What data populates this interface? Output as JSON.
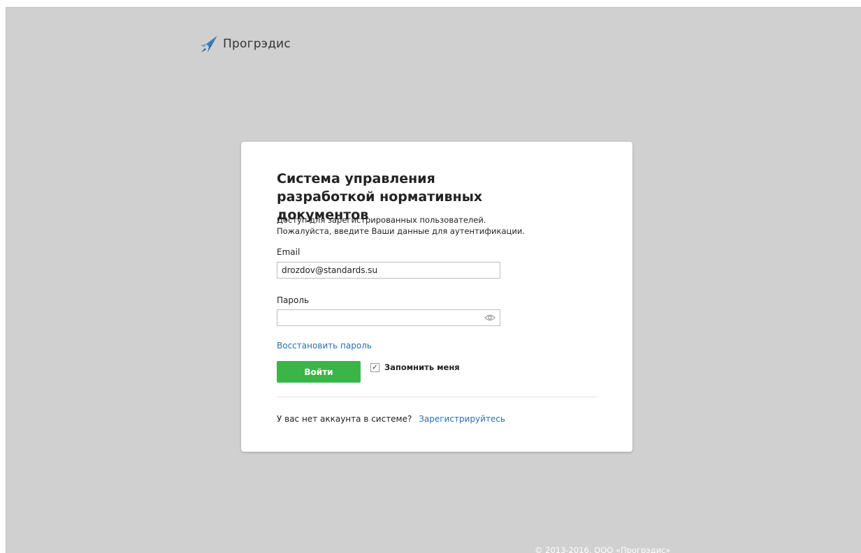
{
  "brand": {
    "name": "Прогрэдис",
    "icon": "rocket-icon",
    "icon_color": "#3a7fc1"
  },
  "card": {
    "title": "Система управления разработкой нормативных документов",
    "intro_line1": "Доступ для зарегистрированных пользователей.",
    "intro_line2": "Пожалуйста, введите Ваши данные для аутентификации."
  },
  "form": {
    "email_label": "Email",
    "email_value": "drozdov@standards.su",
    "password_label": "Пароль",
    "password_value": "",
    "password_toggle_icon": "eye-icon",
    "restore_link": "Восстановить пароль",
    "login_button": "Войти",
    "remember_label": "Запомнить меня",
    "remember_checked": true,
    "remember_check_glyph": "✓"
  },
  "signup": {
    "prompt": "У вас нет аккаунта в системе?",
    "link": "Зарегистрируйтесь"
  },
  "footer": {
    "copyright": "© 2013-2016, ООО «Прогрэдис»"
  },
  "colors": {
    "background": "#d0d0d0",
    "accent_green": "#3bb54a",
    "link_blue": "#2a6fb0"
  }
}
